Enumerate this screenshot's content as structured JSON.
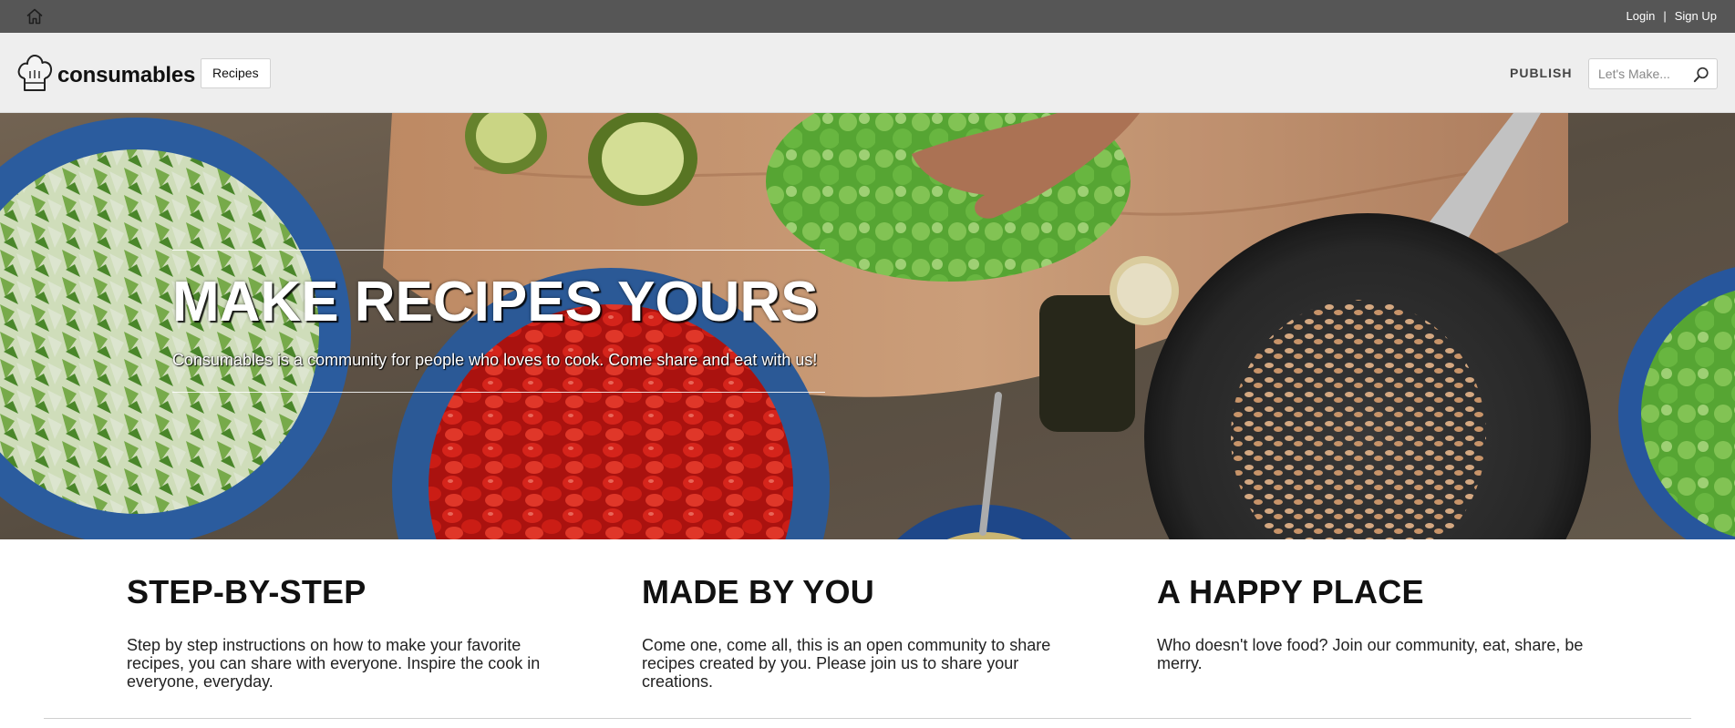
{
  "topbar": {
    "home_icon": "home-icon",
    "login_label": "Login",
    "separator": "|",
    "signup_label": "Sign Up"
  },
  "header": {
    "logo_icon": "chef-hat-icon",
    "logo_text": "consumables",
    "recipes_label": "Recipes",
    "publish_label": "PUBLISH",
    "search": {
      "placeholder": "Let's Make...",
      "value": "",
      "icon": "search-icon"
    }
  },
  "hero": {
    "title": "MAKE RECIPES YOURS",
    "subtitle": "Consumables is a community for people who loves to cook. Come share and eat with us!"
  },
  "features": [
    {
      "title": "STEP-BY-STEP",
      "text": "Step by step instructions on how to make your favorite recipes, you can share with everyone. Inspire the cook in everyone, everyday."
    },
    {
      "title": "MADE BY YOU",
      "text": "Come one, come all, this is an open community to share recipes created by you. Please join us to share your creations."
    },
    {
      "title": "A HAPPY PLACE",
      "text": "Who doesn't love food? Join our community, eat, share, be merry."
    }
  ],
  "colors": {
    "topbar": "#565656",
    "header": "#eeeeee",
    "text": "#111111"
  }
}
